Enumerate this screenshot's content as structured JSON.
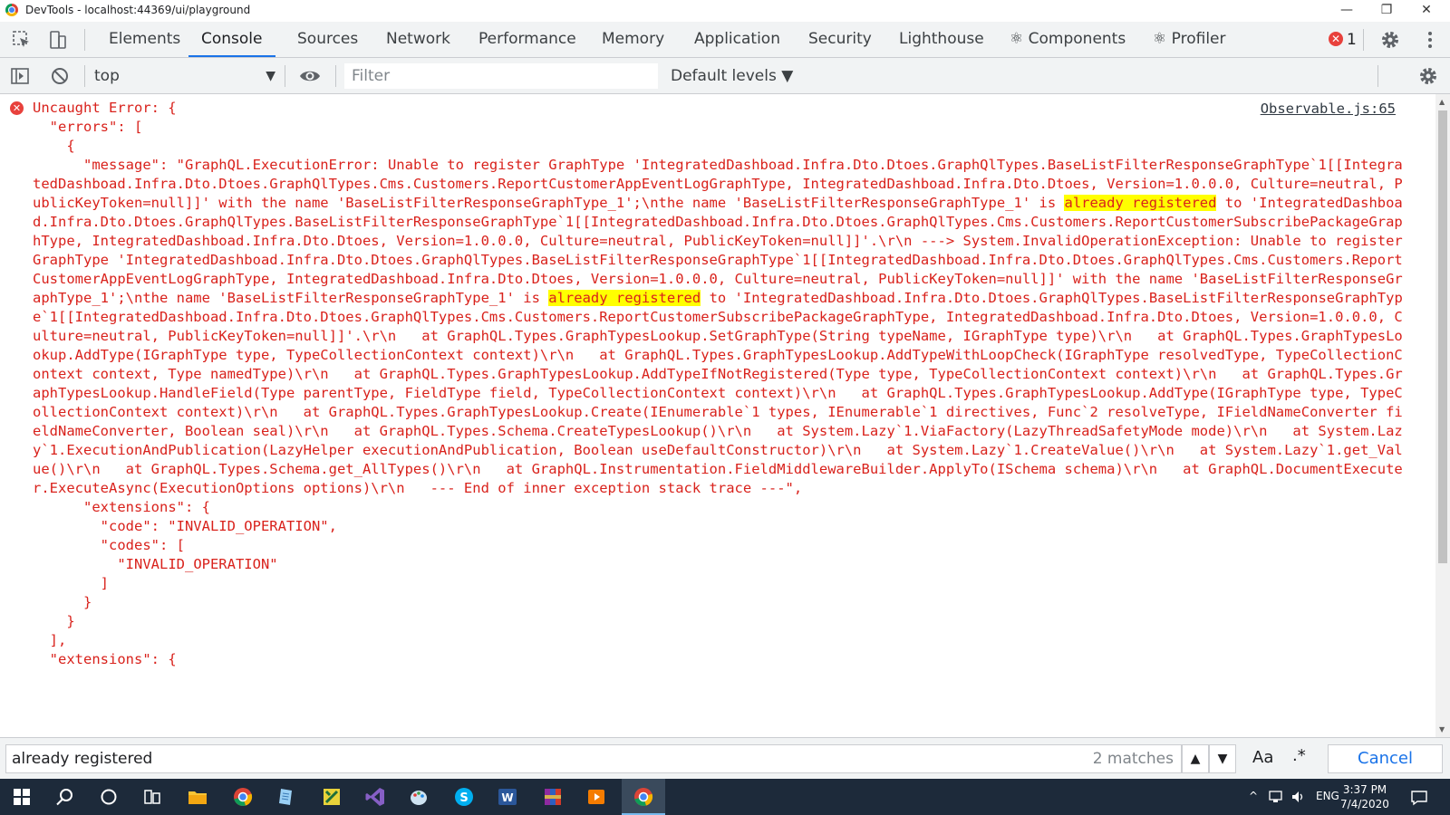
{
  "window": {
    "title": "DevTools - localhost:44369/ui/playground",
    "minimize": "—",
    "restore": "❐",
    "close": "✕"
  },
  "tabs": [
    {
      "label": "Elements"
    },
    {
      "label": "Console"
    },
    {
      "label": "Sources"
    },
    {
      "label": "Network"
    },
    {
      "label": "Performance"
    },
    {
      "label": "Memory"
    },
    {
      "label": "Application"
    },
    {
      "label": "Security"
    },
    {
      "label": "Lighthouse"
    },
    {
      "label": "⚛ Components"
    },
    {
      "label": "⚛ Profiler"
    }
  ],
  "active_tab": "Console",
  "error_count": "1",
  "toolbar": {
    "context": "top",
    "filter_placeholder": "Filter",
    "levels": "Default levels ▼"
  },
  "console": {
    "source_link": "Observable.js:65",
    "message_parts": [
      "Uncaught Error: {\n  \"errors\": [\n    {\n      \"message\": \"GraphQL.ExecutionError: Unable to register GraphType 'IntegratedDashboad.Infra.Dto.Dtoes.GraphQlTypes.BaseListFilterResponseGraphType`1[[IntegratedDashboad.Infra.Dto.Dtoes.GraphQlTypes.Cms.Customers.ReportCustomerAppEventLogGraphType, IntegratedDashboad.Infra.Dto.Dtoes, Version=1.0.0.0, Culture=neutral, PublicKeyToken=null]]' with the name 'BaseListFilterResponseGraphType_1';\\nthe name 'BaseListFilterResponseGraphType_1' is ",
      "already registered",
      " to 'IntegratedDashboad.Infra.Dto.Dtoes.GraphQlTypes.BaseListFilterResponseGraphType`1[[IntegratedDashboad.Infra.Dto.Dtoes.GraphQlTypes.Cms.Customers.ReportCustomerSubscribePackageGraphType, IntegratedDashboad.Infra.Dto.Dtoes, Version=1.0.0.0, Culture=neutral, PublicKeyToken=null]]'.\\r\\n ---> System.InvalidOperationException: Unable to register GraphType 'IntegratedDashboad.Infra.Dto.Dtoes.GraphQlTypes.BaseListFilterResponseGraphType`1[[IntegratedDashboad.Infra.Dto.Dtoes.GraphQlTypes.Cms.Customers.ReportCustomerAppEventLogGraphType, IntegratedDashboad.Infra.Dto.Dtoes, Version=1.0.0.0, Culture=neutral, PublicKeyToken=null]]' with the name 'BaseListFilterResponseGraphType_1';\\nthe name 'BaseListFilterResponseGraphType_1' is ",
      "already registered",
      " to 'IntegratedDashboad.Infra.Dto.Dtoes.GraphQlTypes.BaseListFilterResponseGraphType`1[[IntegratedDashboad.Infra.Dto.Dtoes.GraphQlTypes.Cms.Customers.ReportCustomerSubscribePackageGraphType, IntegratedDashboad.Infra.Dto.Dtoes, Version=1.0.0.0, Culture=neutral, PublicKeyToken=null]]'.\\r\\n   at GraphQL.Types.GraphTypesLookup.SetGraphType(String typeName, IGraphType type)\\r\\n   at GraphQL.Types.GraphTypesLookup.AddType(IGraphType type, TypeCollectionContext context)\\r\\n   at GraphQL.Types.GraphTypesLookup.AddTypeWithLoopCheck(IGraphType resolvedType, TypeCollectionContext context, Type namedType)\\r\\n   at GraphQL.Types.GraphTypesLookup.AddTypeIfNotRegistered(Type type, TypeCollectionContext context)\\r\\n   at GraphQL.Types.GraphTypesLookup.HandleField(Type parentType, FieldType field, TypeCollectionContext context)\\r\\n   at GraphQL.Types.GraphTypesLookup.AddType(IGraphType type, TypeCollectionContext context)\\r\\n   at GraphQL.Types.GraphTypesLookup.Create(IEnumerable`1 types, IEnumerable`1 directives, Func`2 resolveType, IFieldNameConverter fieldNameConverter, Boolean seal)\\r\\n   at GraphQL.Types.Schema.CreateTypesLookup()\\r\\n   at System.Lazy`1.ViaFactory(LazyThreadSafetyMode mode)\\r\\n   at System.Lazy`1.ExecutionAndPublication(LazyHelper executionAndPublication, Boolean useDefaultConstructor)\\r\\n   at System.Lazy`1.CreateValue()\\r\\n   at System.Lazy`1.get_Value()\\r\\n   at GraphQL.Types.Schema.get_AllTypes()\\r\\n   at GraphQL.Instrumentation.FieldMiddlewareBuilder.ApplyTo(ISchema schema)\\r\\n   at GraphQL.DocumentExecuter.ExecuteAsync(ExecutionOptions options)\\r\\n   --- End of inner exception stack trace ---\",\n      \"extensions\": {\n        \"code\": \"INVALID_OPERATION\",\n        \"codes\": [\n          \"INVALID_OPERATION\"\n        ]\n      }\n    }\n  ],\n  \"extensions\": {"
    ]
  },
  "search": {
    "value": "already registered",
    "matches": "2 matches",
    "prev": "▲",
    "next": "▼",
    "case": "Aa",
    "regex": ".*",
    "cancel": "Cancel"
  },
  "taskbar": {
    "language": "ENG",
    "time": "3:37 PM",
    "date": "7/4/2020"
  },
  "colors": {
    "accent": "#1a73e8",
    "error": "#d9221c",
    "highlight": "#ffff00",
    "taskbar": "#1d2a3a"
  }
}
